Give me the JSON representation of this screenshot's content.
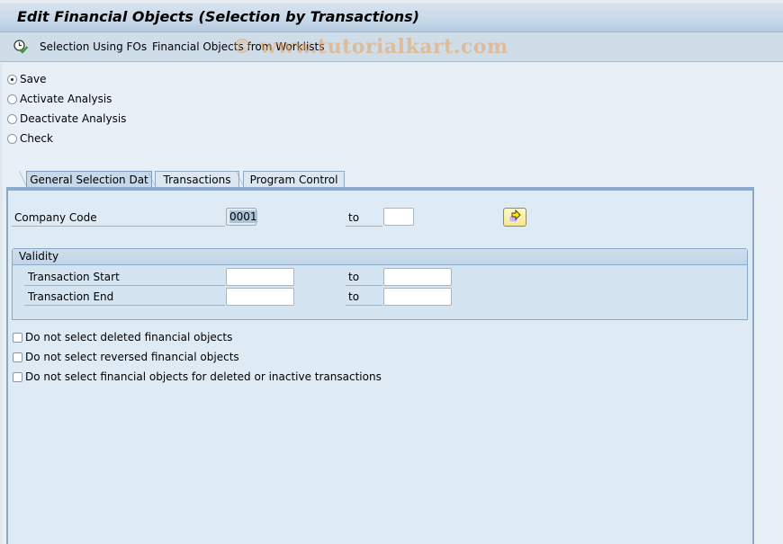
{
  "window": {
    "title": "Edit Financial Objects (Selection by Transactions)"
  },
  "toolbar": {
    "items": [
      {
        "label": "Selection Using FOs",
        "icon": "clock-check-icon"
      },
      {
        "label": "Financial Objects from Worklists"
      }
    ]
  },
  "watermark": "© www.tutorialkart.com",
  "radio_options": [
    {
      "label": "Save",
      "checked": true
    },
    {
      "label": "Activate Analysis",
      "checked": false
    },
    {
      "label": "Deactivate Analysis",
      "checked": false
    },
    {
      "label": "Check",
      "checked": false
    }
  ],
  "tabs": [
    {
      "label": "General Selection Dat",
      "active": true
    },
    {
      "label": "Transactions",
      "active": false
    },
    {
      "label": "Program Control",
      "active": false
    }
  ],
  "company_code": {
    "label": "Company Code",
    "from_value": "0001",
    "to_label": "to",
    "to_value": "",
    "multiple_selection_icon": "multiple-selection-arrow-icon"
  },
  "validity": {
    "title": "Validity",
    "rows": [
      {
        "label": "Transaction Start",
        "from_value": "",
        "to_label": "to",
        "to_value": ""
      },
      {
        "label": "Transaction End",
        "from_value": "",
        "to_label": "to",
        "to_value": ""
      }
    ]
  },
  "checkboxes": [
    {
      "label": "Do not select deleted financial objects",
      "checked": false
    },
    {
      "label": "Do not select reversed financial objects",
      "checked": false
    },
    {
      "label": "Do not select financial objects for deleted or inactive transactions",
      "checked": false
    }
  ]
}
